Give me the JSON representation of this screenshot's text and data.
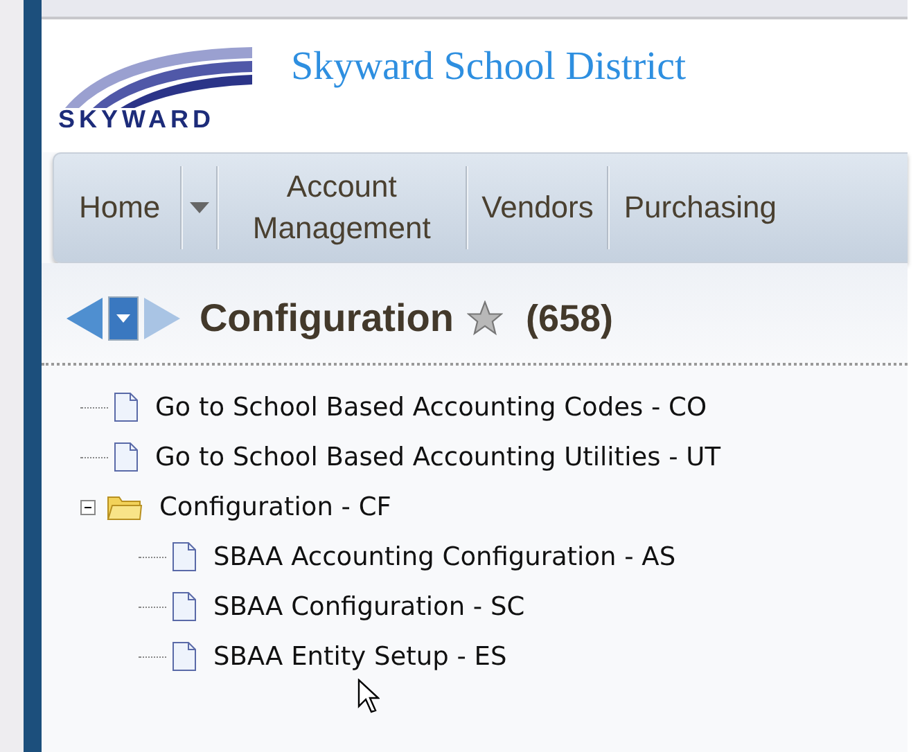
{
  "header": {
    "title": "Skyward School District",
    "logo_text": "SKYWARD"
  },
  "nav": {
    "items": [
      {
        "label": "Home",
        "kind": "link"
      },
      {
        "kind": "dropdown"
      },
      {
        "label": "Account Management",
        "kind": "link"
      },
      {
        "label": "Vendors",
        "kind": "link"
      },
      {
        "label": "Purchasing",
        "kind": "link"
      }
    ]
  },
  "page": {
    "title": "Configuration",
    "count": "(658)",
    "favorite": false
  },
  "tree": [
    {
      "label": "Go to School Based Accounting Codes - CO",
      "kind": "page"
    },
    {
      "label": "Go to School Based Accounting Utilities - UT",
      "kind": "page"
    },
    {
      "label": "Configuration - CF",
      "kind": "folder",
      "expanded": true,
      "children": [
        {
          "label": "SBAA Accounting Configuration - AS",
          "kind": "page"
        },
        {
          "label": "SBAA Configuration - SC",
          "kind": "page"
        },
        {
          "label": "SBAA Entity Setup - ES",
          "kind": "page"
        }
      ]
    }
  ]
}
